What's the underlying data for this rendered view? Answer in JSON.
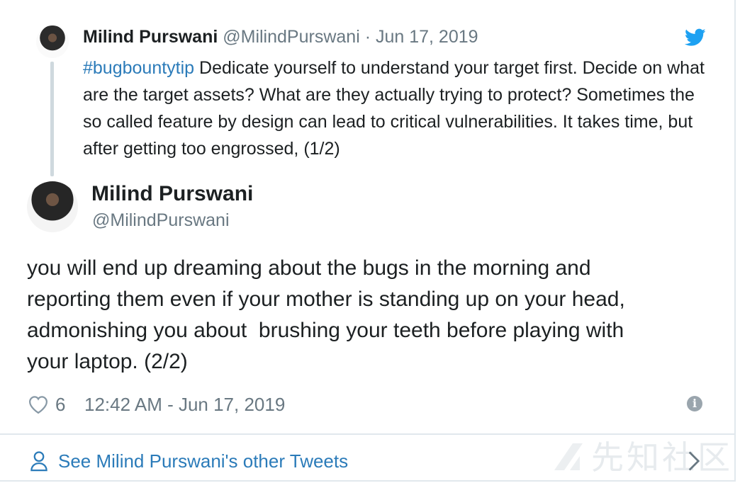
{
  "parent_tweet": {
    "author_name": "Milind Purswani",
    "meta": "@MilindPurswani · Jun 17, 2019",
    "hashtag": "#bugbountytip",
    "text": " Dedicate yourself to understand your target first. Decide on what are the target assets? What are they actually trying to protect? Sometimes the so called feature by design can lead to critical vulnerabilities. It takes time, but after getting too engrossed, (1/2)"
  },
  "main_tweet": {
    "author_name": "Milind Purswani",
    "handle": "@MilindPurswani",
    "text": "you will end up dreaming about the bugs in the morning and\nreporting them even if your mother is standing up on your head,\nadmonishing you about  brushing your teeth before playing with\nyour laptop. (2/2)",
    "like_count": "6",
    "timestamp": "12:42 AM - Jun 17, 2019"
  },
  "footer": {
    "other_tweets_label": "See Milind Purswani's other Tweets"
  },
  "watermark": {
    "text": "先知社区"
  },
  "icons": {
    "brand": "twitter-bird-icon",
    "like": "heart-icon",
    "info": "info-icon",
    "profile": "person-icon",
    "chevron": "chevron-right-icon"
  },
  "colors": {
    "link": "#2b7bb9",
    "twitter_blue": "#1da1f2",
    "meta_gray": "#697882",
    "text": "#1c2022"
  }
}
